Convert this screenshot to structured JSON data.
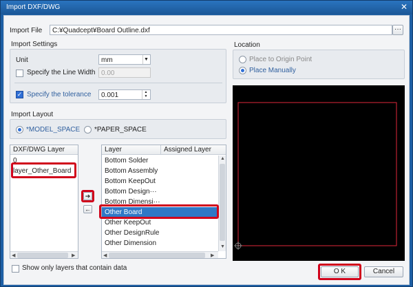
{
  "window": {
    "title": "Import DXF/DWG",
    "close_glyph": "✕"
  },
  "import_file": {
    "label": "Import File",
    "value": "C:¥Quadcept¥Board Outline.dxf",
    "browse_label": "···"
  },
  "import_settings": {
    "title": "Import Settings",
    "unit_label": "Unit",
    "unit_value": "mm",
    "line_width_label": "Specify the Line Width",
    "line_width_checked": false,
    "line_width_value": "0.00",
    "tolerance_label": "Specify the tolerance",
    "tolerance_checked": true,
    "tolerance_value": "0.001"
  },
  "import_layout": {
    "title": "Import Layout",
    "options": [
      {
        "label": "*MODEL_SPACE",
        "checked": true
      },
      {
        "label": "*PAPER_SPACE",
        "checked": false
      }
    ]
  },
  "location": {
    "title": "Location",
    "options": [
      {
        "label": "Place to Origin Point",
        "checked": false
      },
      {
        "label": "Place Manually",
        "checked": true
      }
    ]
  },
  "dxf_layers": {
    "header": "DXF/DWG Layer",
    "items": [
      "0",
      "layer_Other_Board"
    ]
  },
  "transfer": {
    "right_arrow": "➔",
    "left_arrow": "←"
  },
  "target_layers": {
    "headers": [
      "Layer",
      "Assigned Layer"
    ],
    "items": [
      "Bottom Solder",
      "Bottom Assembly",
      "Bottom KeepOut",
      "Bottom Design···",
      "Bottom Dimensi···",
      "Other Board",
      "Other KeepOut",
      "Other DesignRule",
      "Other Dimension"
    ],
    "selected": "Other Board"
  },
  "show_only_label": "Show only layers that contain data",
  "buttons": {
    "ok": "O K",
    "cancel": "Cancel"
  },
  "colors": {
    "highlight": "#d0021b",
    "selection": "#2f78c6",
    "preview_bg": "#000000",
    "outline": "#e0283a"
  }
}
